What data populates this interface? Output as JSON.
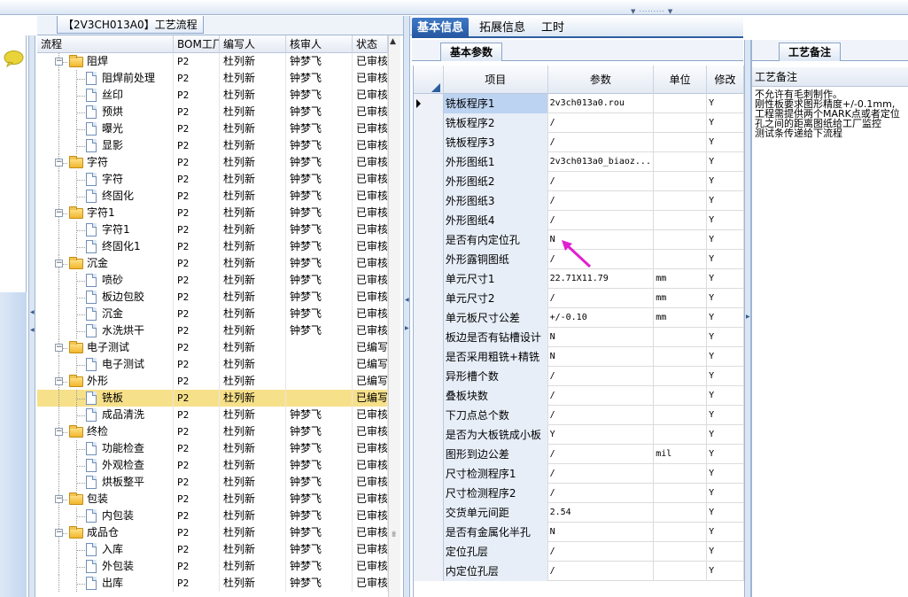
{
  "window": {
    "title_tab": "【2V3CH013A0】工艺流程"
  },
  "tree": {
    "columns": [
      "流程",
      "BOM工厂",
      "编写人",
      "核审人",
      "状态"
    ],
    "rows": [
      {
        "indent": 1,
        "type": "folder",
        "name": "阻焊",
        "bom": "P2",
        "writer": "杜列新",
        "reviewer": "钟梦飞",
        "status": "已审核"
      },
      {
        "indent": 2,
        "type": "doc",
        "name": "阻焊前处理",
        "bom": "P2",
        "writer": "杜列新",
        "reviewer": "钟梦飞",
        "status": "已审核"
      },
      {
        "indent": 2,
        "type": "doc",
        "name": "丝印",
        "bom": "P2",
        "writer": "杜列新",
        "reviewer": "钟梦飞",
        "status": "已审核"
      },
      {
        "indent": 2,
        "type": "doc",
        "name": "预烘",
        "bom": "P2",
        "writer": "杜列新",
        "reviewer": "钟梦飞",
        "status": "已审核"
      },
      {
        "indent": 2,
        "type": "doc",
        "name": "曝光",
        "bom": "P2",
        "writer": "杜列新",
        "reviewer": "钟梦飞",
        "status": "已审核"
      },
      {
        "indent": 2,
        "type": "doc",
        "name": "显影",
        "bom": "P2",
        "writer": "杜列新",
        "reviewer": "钟梦飞",
        "status": "已审核"
      },
      {
        "indent": 1,
        "type": "folder",
        "name": "字符",
        "bom": "P2",
        "writer": "杜列新",
        "reviewer": "钟梦飞",
        "status": "已审核"
      },
      {
        "indent": 2,
        "type": "doc",
        "name": "字符",
        "bom": "P2",
        "writer": "杜列新",
        "reviewer": "钟梦飞",
        "status": "已审核"
      },
      {
        "indent": 2,
        "type": "doc",
        "name": "终固化",
        "bom": "P2",
        "writer": "杜列新",
        "reviewer": "钟梦飞",
        "status": "已审核"
      },
      {
        "indent": 1,
        "type": "folder",
        "name": "字符1",
        "bom": "P2",
        "writer": "杜列新",
        "reviewer": "钟梦飞",
        "status": "已审核"
      },
      {
        "indent": 2,
        "type": "doc",
        "name": "字符1",
        "bom": "P2",
        "writer": "杜列新",
        "reviewer": "钟梦飞",
        "status": "已审核"
      },
      {
        "indent": 2,
        "type": "doc",
        "name": "终固化1",
        "bom": "P2",
        "writer": "杜列新",
        "reviewer": "钟梦飞",
        "status": "已审核"
      },
      {
        "indent": 1,
        "type": "folder",
        "name": "沉金",
        "bom": "P2",
        "writer": "杜列新",
        "reviewer": "钟梦飞",
        "status": "已审核"
      },
      {
        "indent": 2,
        "type": "doc",
        "name": "喷砂",
        "bom": "P2",
        "writer": "杜列新",
        "reviewer": "钟梦飞",
        "status": "已审核"
      },
      {
        "indent": 2,
        "type": "doc",
        "name": "板边包胶",
        "bom": "P2",
        "writer": "杜列新",
        "reviewer": "钟梦飞",
        "status": "已审核"
      },
      {
        "indent": 2,
        "type": "doc",
        "name": "沉金",
        "bom": "P2",
        "writer": "杜列新",
        "reviewer": "钟梦飞",
        "status": "已审核"
      },
      {
        "indent": 2,
        "type": "doc",
        "name": "水洗烘干",
        "bom": "P2",
        "writer": "杜列新",
        "reviewer": "钟梦飞",
        "status": "已审核"
      },
      {
        "indent": 1,
        "type": "folder",
        "name": "电子测试",
        "bom": "P2",
        "writer": "杜列新",
        "reviewer": "",
        "status": "已编写"
      },
      {
        "indent": 2,
        "type": "doc",
        "name": "电子测试",
        "bom": "P2",
        "writer": "杜列新",
        "reviewer": "",
        "status": "已编写"
      },
      {
        "indent": 1,
        "type": "folder",
        "name": "外形",
        "bom": "P2",
        "writer": "杜列新",
        "reviewer": "",
        "status": "已编写"
      },
      {
        "indent": 2,
        "type": "doc",
        "name": "铣板",
        "bom": "P2",
        "writer": "杜列新",
        "reviewer": "",
        "status": "已编写",
        "selected": true
      },
      {
        "indent": 2,
        "type": "doc",
        "name": "成品清洗",
        "bom": "P2",
        "writer": "杜列新",
        "reviewer": "钟梦飞",
        "status": "已审核"
      },
      {
        "indent": 1,
        "type": "folder",
        "name": "终检",
        "bom": "P2",
        "writer": "杜列新",
        "reviewer": "钟梦飞",
        "status": "已审核"
      },
      {
        "indent": 2,
        "type": "doc",
        "name": "功能检查",
        "bom": "P2",
        "writer": "杜列新",
        "reviewer": "钟梦飞",
        "status": "已审核"
      },
      {
        "indent": 2,
        "type": "doc",
        "name": "外观检查",
        "bom": "P2",
        "writer": "杜列新",
        "reviewer": "钟梦飞",
        "status": "已审核"
      },
      {
        "indent": 2,
        "type": "doc",
        "name": "烘板整平",
        "bom": "P2",
        "writer": "杜列新",
        "reviewer": "钟梦飞",
        "status": "已审核"
      },
      {
        "indent": 1,
        "type": "folder",
        "name": "包装",
        "bom": "P2",
        "writer": "杜列新",
        "reviewer": "钟梦飞",
        "status": "已审核"
      },
      {
        "indent": 2,
        "type": "doc",
        "name": "内包装",
        "bom": "P2",
        "writer": "杜列新",
        "reviewer": "钟梦飞",
        "status": "已审核"
      },
      {
        "indent": 1,
        "type": "folder",
        "name": "成品仓",
        "bom": "P2",
        "writer": "杜列新",
        "reviewer": "钟梦飞",
        "status": "已审核"
      },
      {
        "indent": 2,
        "type": "doc",
        "name": "入库",
        "bom": "P2",
        "writer": "杜列新",
        "reviewer": "钟梦飞",
        "status": "已审核"
      },
      {
        "indent": 2,
        "type": "doc",
        "name": "外包装",
        "bom": "P2",
        "writer": "杜列新",
        "reviewer": "钟梦飞",
        "status": "已审核"
      },
      {
        "indent": 2,
        "type": "doc",
        "name": "出库",
        "bom": "P2",
        "writer": "杜列新",
        "reviewer": "钟梦飞",
        "status": "已审核"
      }
    ]
  },
  "tabs": {
    "basic": "基本信息",
    "extended": "拓展信息",
    "hours": "工时"
  },
  "subtab": "基本参数",
  "grid": {
    "columns": [
      "项目",
      "参数",
      "单位",
      "修改"
    ],
    "rows": [
      {
        "item": "铣板程序1",
        "param": "2v3ch013a0.rou",
        "unit": "",
        "mod": "Y"
      },
      {
        "item": "铣板程序2",
        "param": "/",
        "unit": "",
        "mod": "Y"
      },
      {
        "item": "铣板程序3",
        "param": "/",
        "unit": "",
        "mod": "Y"
      },
      {
        "item": "外形图纸1",
        "param": "2v3ch013a0_biaoz...",
        "unit": "",
        "mod": "Y"
      },
      {
        "item": "外形图纸2",
        "param": "/",
        "unit": "",
        "mod": "Y"
      },
      {
        "item": "外形图纸3",
        "param": "/",
        "unit": "",
        "mod": "Y"
      },
      {
        "item": "外形图纸4",
        "param": "/",
        "unit": "",
        "mod": "Y"
      },
      {
        "item": "是否有内定位孔",
        "param": "N",
        "unit": "",
        "mod": "Y"
      },
      {
        "item": "外形露铜图纸",
        "param": "/",
        "unit": "",
        "mod": "Y"
      },
      {
        "item": "单元尺寸1",
        "param": "22.71X11.79",
        "unit": "mm",
        "mod": "Y"
      },
      {
        "item": "单元尺寸2",
        "param": "/",
        "unit": "mm",
        "mod": "Y"
      },
      {
        "item": "单元板尺寸公差",
        "param": "+/-0.10",
        "unit": "mm",
        "mod": "Y"
      },
      {
        "item": "板边是否有钻槽设计",
        "param": "N",
        "unit": "",
        "mod": "Y"
      },
      {
        "item": "是否采用粗铣+精铣",
        "param": "N",
        "unit": "",
        "mod": "Y"
      },
      {
        "item": "异形槽个数",
        "param": "/",
        "unit": "",
        "mod": "Y"
      },
      {
        "item": "叠板块数",
        "param": "/",
        "unit": "",
        "mod": "Y"
      },
      {
        "item": "下刀点总个数",
        "param": "/",
        "unit": "",
        "mod": "Y"
      },
      {
        "item": "是否为大板铣成小板",
        "param": "Y",
        "unit": "",
        "mod": "Y"
      },
      {
        "item": "图形到边公差",
        "param": "/",
        "unit": "mil",
        "mod": "Y"
      },
      {
        "item": "尺寸检测程序1",
        "param": "/",
        "unit": "",
        "mod": "Y"
      },
      {
        "item": "尺寸检测程序2",
        "param": "/",
        "unit": "",
        "mod": "Y"
      },
      {
        "item": "交货单元间距",
        "param": "2.54",
        "unit": "",
        "mod": "Y"
      },
      {
        "item": "是否有金属化半孔",
        "param": "N",
        "unit": "",
        "mod": "Y"
      },
      {
        "item": "定位孔层",
        "param": "/",
        "unit": "",
        "mod": "Y"
      },
      {
        "item": "内定位孔层",
        "param": "/",
        "unit": "",
        "mod": "Y"
      }
    ]
  },
  "right": {
    "tab": "工艺备注",
    "header": "工艺备注",
    "note": "不允许有毛刺制作。\n刚性板要求图形精度+/-0.1mm,\n工程需提供两个MARK点或者定位\n孔之间的距离图纸给工厂监控\n测试条传递给下流程"
  },
  "colors": {
    "accent": "#2556a0",
    "selected_row": "#f7e08a",
    "arrow": "#e020d0"
  }
}
